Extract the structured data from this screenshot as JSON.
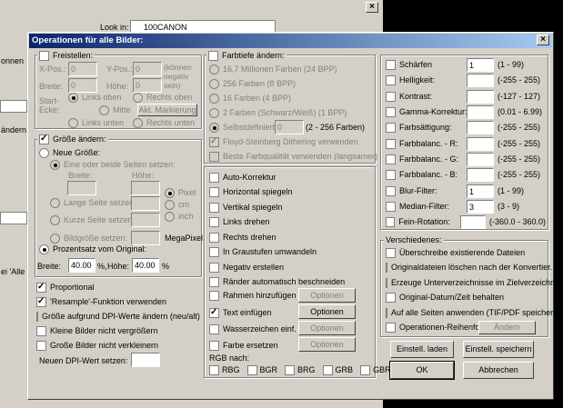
{
  "bg": {
    "lookin_label": "Look in:",
    "lookin_value": "100CANON",
    "left_frag": [
      "onnen",
      "ändern u",
      "ei 'Alle hi"
    ]
  },
  "title": "Operationen für alle Bilder:",
  "freistellen": {
    "label": "Freistellen:",
    "xpos": "X-Pos.:",
    "xval": "0",
    "ypos": "Y-Pos.:",
    "yval": "0",
    "note": "(können negativ sein)",
    "breite": "Breite:",
    "breite_val": "0",
    "hoehe": "Höhe:",
    "hoehe_val": "0",
    "start": "Start-Ecke:",
    "links_oben": "Links oben",
    "rechts_oben": "Rechts oben",
    "mitte": "Mitte",
    "markierung": "Akt. Markierung",
    "links_unten": "Links unten",
    "rechts_unten": "Rechts unten"
  },
  "groesse": {
    "label": "Größe ändern:",
    "neue": "Neue Größe:",
    "beide": "Eine oder beide Seiten setzen:",
    "breite": "Breite:",
    "hoehe": "Höhe:",
    "lange": "Lange Seite setzen:",
    "kurze": "Kurze Seite setzen:",
    "bild": "Bildgröße setzen:",
    "pixel": "Pixel",
    "cm": "cm",
    "inch": "inch",
    "mega": "MegaPixel",
    "prozent": "Prozentsatz vom Original:",
    "p_breite": "Breite:",
    "p_breite_val": "40.00",
    "p_pct1": "%,",
    "p_hoehe": "Höhe:",
    "p_hoehe_val": "40.00",
    "p_pct2": "%"
  },
  "opts_left": [
    {
      "label": "Proportional",
      "on": true
    },
    {
      "label": "'Resample'-Funktion verwenden",
      "on": true
    },
    {
      "label": "Größe aufgrund DPI-Werte ändern (neu/alt)",
      "on": false
    },
    {
      "label": "Kleine Bilder nicht vergrößern",
      "on": false
    },
    {
      "label": "Große Bilder nicht verkleinern",
      "on": false
    }
  ],
  "dpi_label": "Neuen DPI-Wert setzen:",
  "farbtiefe": {
    "label": "Farbtiefe ändern:",
    "items": [
      "16,7 Millionen Farben (24 BPP)",
      "256 Farben (8 BPP)",
      "16 Farben (4 BPP)",
      "2 Farben (Schwarz/Weiß) (1 BPP)"
    ],
    "custom": "Selbstdefiniert:",
    "custom_val": "0",
    "custom_range": "(2 - 256 Farben)",
    "floyd": "Floyd-Steinberg Dithering verwenden",
    "beste": "Beste Farbqualität verwenden (langsamer)"
  },
  "mid": [
    {
      "label": "Auto-Korrektur",
      "on": false
    },
    {
      "label": "Horizontal spiegeln",
      "on": false
    },
    {
      "label": "Vertikal spiegeln",
      "on": false
    },
    {
      "label": "Links drehen",
      "on": false
    },
    {
      "label": "Rechts drehen",
      "on": false
    },
    {
      "label": "In Graustufen umwandeln",
      "on": false
    },
    {
      "label": "Negativ erstellen",
      "on": false
    },
    {
      "label": "Ränder automatisch beschneiden",
      "on": false
    }
  ],
  "mid_btn": [
    {
      "label": "Rahmen hinzufügen",
      "btn": "Optionen",
      "on": false,
      "enabled": false
    },
    {
      "label": "Text einfügen",
      "btn": "Optionen",
      "on": true,
      "enabled": true
    },
    {
      "label": "Wasserzeichen einf.",
      "btn": "Optionen",
      "on": false,
      "enabled": false
    },
    {
      "label": "Farbe ersetzen",
      "btn": "Optionen",
      "on": false,
      "enabled": false
    }
  ],
  "rgb": {
    "label": "RGB nach:",
    "opts": [
      "RBG",
      "BGR",
      "BRG",
      "GRB",
      "GBR"
    ]
  },
  "adjust": [
    {
      "label": "Schärfen",
      "val": "1",
      "range": "(1 - 99)"
    },
    {
      "label": "Helligkeit:",
      "val": "",
      "range": "(-255 - 255)"
    },
    {
      "label": "Kontrast:",
      "val": "",
      "range": "(-127 - 127)"
    },
    {
      "label": "Gamma-Korrektur:",
      "val": "",
      "range": "(0.01 - 6.99)"
    },
    {
      "label": "Farbsättigung:",
      "val": "",
      "range": "(-255 - 255)"
    },
    {
      "label": "Farbbalanc. - R:",
      "val": "",
      "range": "(-255 - 255)"
    },
    {
      "label": "Farbbalanc. - G:",
      "val": "",
      "range": "(-255 - 255)"
    },
    {
      "label": "Farbbalanc. - B:",
      "val": "",
      "range": "(-255 - 255)"
    },
    {
      "label": "Blur-Filter:",
      "val": "1",
      "range": "(1 - 99)"
    },
    {
      "label": "Median-Filter:",
      "val": "3",
      "range": "(3 - 9)"
    },
    {
      "label": "Fein-Rotation:",
      "val": "",
      "range": "(-360.0 - 360.0)"
    }
  ],
  "versch": {
    "label": "Verschiedenes:",
    "items": [
      "Überschreibe existierende Dateien",
      "Originaldateien löschen nach der Konvertier.",
      "Erzeuge Unterverzeichnisse im Zielverzeichn.",
      "Original-Datum/Zeit behalten",
      "Auf alle Seiten anwenden (TIF/PDF speichern)",
      "Operationen-Reihenfolge"
    ],
    "aendern": "Ändern"
  },
  "buttons": {
    "laden": "Einstell. laden",
    "speichern": "Einstell. speichern",
    "ok": "OK",
    "abbrechen": "Abbrechen"
  }
}
